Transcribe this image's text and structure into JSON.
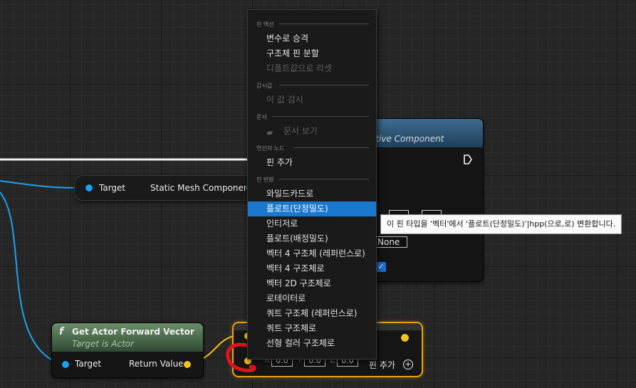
{
  "context_menu": {
    "sections": [
      {
        "header": "핀 액션",
        "items": [
          {
            "label": "변수로 승격",
            "disabled": false
          },
          {
            "label": "구조체 핀 분할",
            "disabled": false
          },
          {
            "label": "디폴트값으로 리셋",
            "disabled": true
          }
        ]
      },
      {
        "header": "감시값",
        "items": [
          {
            "label": "이 값 감시",
            "disabled": true
          }
        ]
      },
      {
        "header": "문서",
        "items": [
          {
            "label": "문서 보기",
            "disabled": true
          }
        ]
      },
      {
        "header": "연산자 노드",
        "items": [
          {
            "label": "핀 추가",
            "disabled": false
          }
        ]
      },
      {
        "header": "핀 변환",
        "items": [
          {
            "label": "와일드카드로"
          },
          {
            "label": "플로트(단정밀도)",
            "highlighted": true
          },
          {
            "label": "인티저로"
          },
          {
            "label": "플로트(배정밀도)"
          },
          {
            "label": "벡터 4 구조체 (레퍼런스로)"
          },
          {
            "label": "벡터 4 구조체로"
          },
          {
            "label": "벡터 2D 구조체로"
          },
          {
            "label": "로테이터로"
          },
          {
            "label": "쿼트 구조체 (레퍼런스로)"
          },
          {
            "label": "쿼트 구조체로"
          },
          {
            "label": "선형 컬러 구조체로"
          }
        ]
      }
    ]
  },
  "tooltip": "이 핀 타입을 '벡터'에서 '플로트(단정밀도)'|hpp(으로,로) 변환합니다.",
  "nodes": {
    "pure": {
      "target": "Target",
      "output": "Static Mesh Component"
    },
    "primitive": {
      "header": "itive Component",
      "none_value": "None"
    },
    "forward_vector": {
      "title": "Get Actor Forward Vector",
      "subtitle": "Target is Actor",
      "input": "Target",
      "output": "Return Value",
      "fx_icon": "f"
    },
    "vector_add": {
      "x_label": "X",
      "y_label": "Y",
      "z_label": "Z",
      "x": "0.0",
      "y": "0.0",
      "z": "0.0",
      "add_pin": "핀 추가"
    }
  },
  "colors": {
    "object_pin": "#1da2f0",
    "vector_pin": "#f2c21b",
    "highlight": "#1a78cf",
    "selection_border": "#e9a20e",
    "annotation": "#e0141c"
  }
}
